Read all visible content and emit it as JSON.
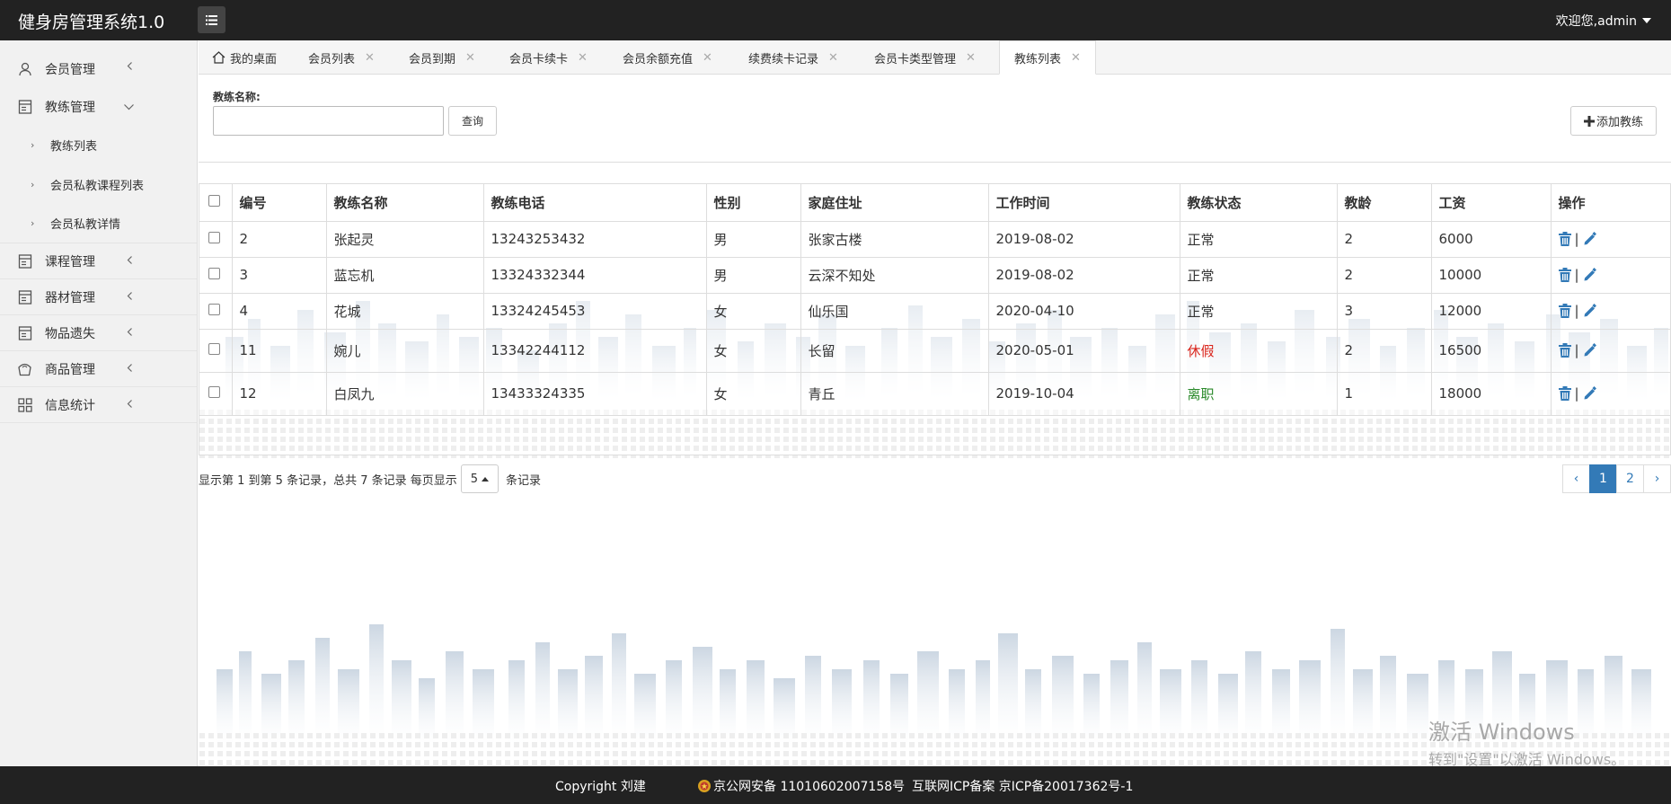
{
  "app": {
    "title": "健身房管理系统1.0",
    "welcome": "欢迎您,admin"
  },
  "sidebar": {
    "items": [
      {
        "label": "会员管理",
        "icon": "user-icon",
        "expanded": false
      },
      {
        "label": "教练管理",
        "icon": "document-icon",
        "expanded": true,
        "children": [
          "教练列表",
          "会员私教课程列表",
          "会员私教详情"
        ]
      },
      {
        "label": "课程管理",
        "icon": "document-icon",
        "expanded": false
      },
      {
        "label": "器材管理",
        "icon": "document-icon",
        "expanded": false
      },
      {
        "label": "物品遗失",
        "icon": "document-icon",
        "expanded": false
      },
      {
        "label": "商品管理",
        "icon": "bag-icon",
        "expanded": false
      },
      {
        "label": "信息统计",
        "icon": "grid-icon",
        "expanded": false
      }
    ]
  },
  "tabs": [
    "我的桌面",
    "会员列表",
    "会员到期",
    "会员卡续卡",
    "会员余额充值",
    "续费续卡记录",
    "会员卡类型管理",
    "教练列表"
  ],
  "search": {
    "label": "教练名称:",
    "value": "",
    "query_button": "查询",
    "add_button": "添加教练"
  },
  "table": {
    "headers": [
      "编号",
      "教练名称",
      "教练电话",
      "性别",
      "家庭住址",
      "工作时间",
      "教练状态",
      "教龄",
      "工资",
      "操作"
    ],
    "rows": [
      [
        "2",
        "张起灵",
        "13243253432",
        "男",
        "张家古楼",
        "2019-08-02",
        "正常",
        "2",
        "6000"
      ],
      [
        "3",
        "蓝忘机",
        "13324332344",
        "男",
        "云深不知处",
        "2019-08-02",
        "正常",
        "2",
        "10000"
      ],
      [
        "4",
        "花城",
        "13324245453",
        "女",
        "仙乐国",
        "2020-04-10",
        "正常",
        "3",
        "12000"
      ],
      [
        "11",
        "婉儿",
        "13342244112",
        "女",
        "长留",
        "2020-05-01",
        "休假",
        "2",
        "16500"
      ],
      [
        "12",
        "白凤九",
        "13433324335",
        "女",
        "青丘",
        "2019-10-04",
        "离职",
        "1",
        "18000"
      ]
    ],
    "op_separator": "|"
  },
  "pager": {
    "info_prefix": "显示第 1 到第 5 条记录，总共 7 条记录 每页显示",
    "page_size": "5",
    "info_suffix": "条记录",
    "prev": "‹",
    "pages": [
      "1",
      "2"
    ],
    "current": "1",
    "next": "›"
  },
  "watermark": {
    "line1": "激活 Windows",
    "line2": "转到\"设置\"以激活 Windows。"
  },
  "footer": {
    "copyright": "Copyright 刘建",
    "police": "京公网安备 11010602007158号",
    "icp": "互联网ICP备案 京ICP备20017362号-1"
  },
  "colors": {
    "topbar": "#222222",
    "accent": "#337ab7",
    "status_red": "#d9231a",
    "status_green": "#2a8a2a"
  }
}
